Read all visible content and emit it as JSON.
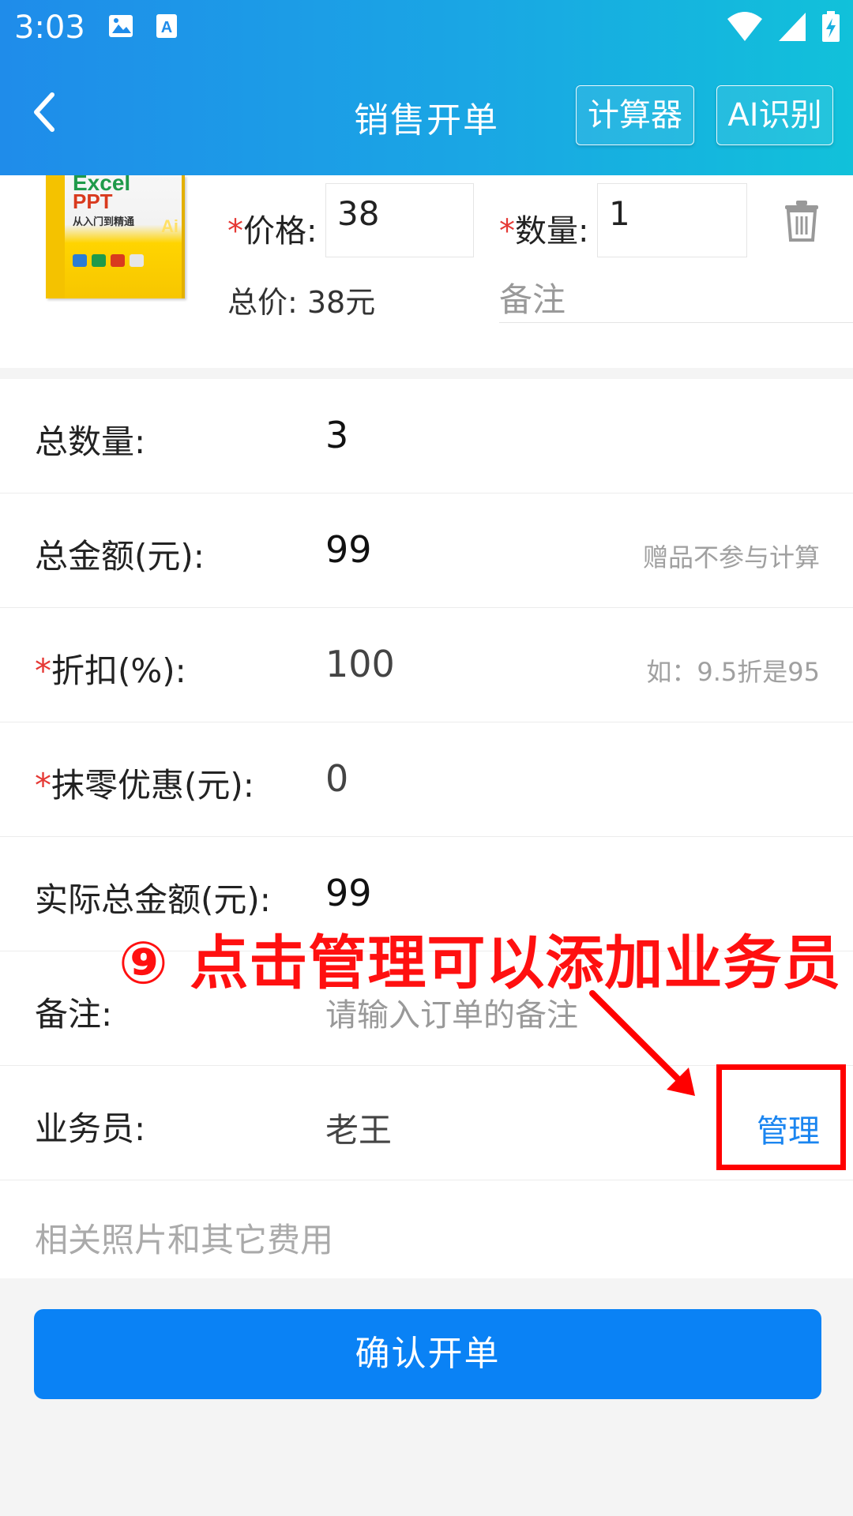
{
  "status_bar": {
    "time": "3:03",
    "left_icons": [
      "image-icon",
      "app-a-icon"
    ],
    "right_icons": [
      "wifi-icon",
      "signal-icon",
      "battery-charging-icon"
    ]
  },
  "nav": {
    "title": "销售开单",
    "calculator_label": "计算器",
    "ai_label": "AI识别",
    "back_icon": "back-arrow-icon"
  },
  "product": {
    "cover_lines": [
      "Excel",
      "PPT",
      "从入门到精通"
    ],
    "cover_mark": "Ai",
    "price_label": "价格:",
    "price_value": "38",
    "qty_label": "数量:",
    "qty_value": "1",
    "total_price": "总价: 38元",
    "note_placeholder": "备注",
    "delete_icon": "trash-icon"
  },
  "form": {
    "total_qty_label": "总数量:",
    "total_qty_value": "3",
    "total_amount_label": "总金额(元):",
    "total_amount_value": "99",
    "total_amount_hint": "赠品不参与计算",
    "discount_label": "折扣(%):",
    "discount_value": "100",
    "discount_hint": "如：9.5折是95",
    "rounding_label": "抹零优惠(元):",
    "rounding_value": "0",
    "actual_total_label": "实际总金额(元):",
    "actual_total_value": "99",
    "remark_label": "备注:",
    "remark_placeholder": "请输入订单的备注",
    "salesperson_label": "业务员:",
    "salesperson_value": "老王",
    "manage_label": "管理",
    "photos_label": "相关照片和其它费用"
  },
  "submit_label": "确认开单",
  "annotation": {
    "text": "⑨ 点击管理可以添加业务员",
    "color": "#ff0000"
  },
  "colors": {
    "header_start": "#1f8cea",
    "header_end": "#11c1da",
    "primary": "#0a82f5",
    "required": "#e53935",
    "link": "#1a85f0"
  }
}
